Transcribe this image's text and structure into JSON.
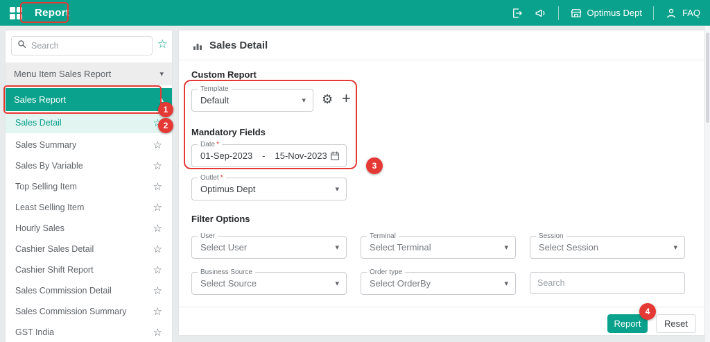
{
  "colors": {
    "accent": "#0aa28c",
    "annotation": "#e53935",
    "active_item_bg": "#e3f5f1"
  },
  "icons": {
    "star": "☆",
    "chevron_down": "▾",
    "chevron_up": "▴",
    "gear": "⚙",
    "plus": "+"
  },
  "topbar": {
    "title": "Report",
    "dept_label": "Optimus Dept",
    "faq_label": "FAQ"
  },
  "sidebar": {
    "search_placeholder": "Search",
    "dropdown_value": "Menu Item Sales Report",
    "group_label": "Sales Report",
    "active_item": "Sales Detail",
    "items": [
      "Sales Summary",
      "Sales By Variable",
      "Top Selling Item",
      "Least Selling Item",
      "Hourly Sales",
      "Cashier Sales Detail",
      "Cashier Shift Report",
      "Sales Commission Detail",
      "Sales Commission Summary",
      "GST India"
    ]
  },
  "main": {
    "title": "Sales Detail",
    "section_custom": "Custom Report",
    "section_mandatory": "Mandatory Fields",
    "section_filters": "Filter Options",
    "required_marker": "*",
    "template": {
      "label": "Template",
      "value": "Default"
    },
    "date": {
      "label": "Date",
      "from": "01-Sep-2023",
      "separator": "-",
      "to": "15-Nov-2023"
    },
    "outlet": {
      "label": "Outlet",
      "value": "Optimus Dept"
    },
    "filters": [
      {
        "label": "User",
        "value": "Select User"
      },
      {
        "label": "Terminal",
        "value": "Select Terminal"
      },
      {
        "label": "Session",
        "value": "Select Session"
      },
      {
        "label": "Business Source",
        "value": "Select Source"
      },
      {
        "label": "Order type",
        "value": "Select OrderBy"
      }
    ],
    "filter_search_placeholder": "Search",
    "report_button": "Report",
    "reset_button": "Reset"
  },
  "annotations": {
    "step1": "1",
    "step2": "2",
    "step3": "3",
    "step4": "4"
  }
}
